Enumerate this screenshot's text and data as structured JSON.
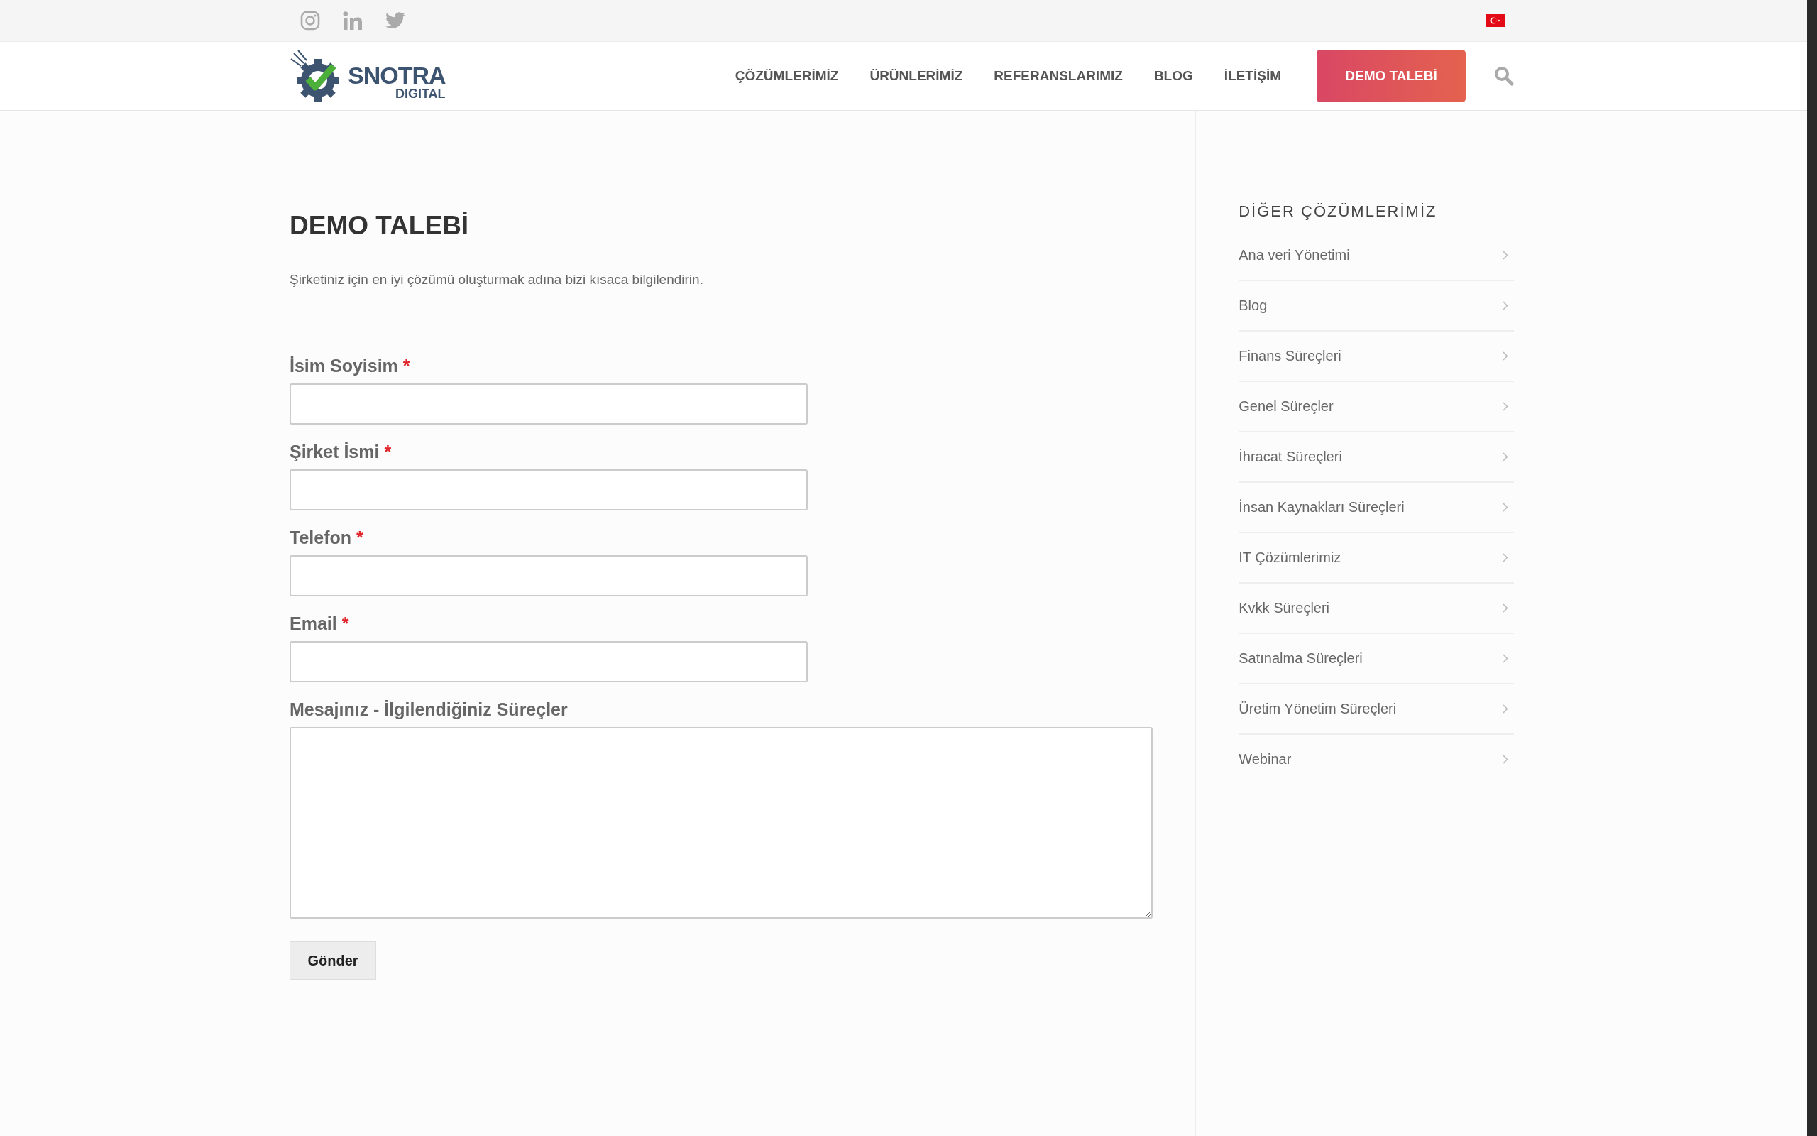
{
  "header": {
    "logo": {
      "name": "SNOTRA",
      "subtitle": "DIGITAL"
    },
    "nav": [
      {
        "label": "ÇÖZÜMLERİMİZ"
      },
      {
        "label": "ÜRÜNLERİMİZ"
      },
      {
        "label": "REFERANSLARIMIZ"
      },
      {
        "label": "BLOG"
      },
      {
        "label": "İLETİŞİM"
      }
    ],
    "cta_button": "DEMO TALEBİ"
  },
  "page": {
    "title": "DEMO TALEBİ",
    "intro": "Şirketiniz için en iyi çözümü oluşturmak adına bizi kısaca bilgilendirin.",
    "fields": [
      {
        "label": "İsim Soyisim",
        "required_mark": "*",
        "kind": "input"
      },
      {
        "label": "Şirket İsmi",
        "required_mark": "*",
        "kind": "input"
      },
      {
        "label": "Telefon",
        "required_mark": "*",
        "kind": "input"
      },
      {
        "label": "Email",
        "required_mark": "*",
        "kind": "input"
      },
      {
        "label": "Mesajınız - İlgilendiğiniz Süreçler",
        "kind": "textarea"
      }
    ],
    "submit_button": "Gönder"
  },
  "sidebar": {
    "title": "DİĞER ÇÖZÜMLERİMİZ",
    "items": [
      "Ana veri Yönetimi",
      "Blog",
      "Finans Süreçleri",
      "Genel Süreçler",
      "İhracat Süreçleri",
      "İnsan Kaynakları Süreçleri",
      "IT Çözümlerimiz",
      "Kvkk Süreçleri",
      "Satınalma Süreçleri",
      "Üretim Yönetim Süreçleri",
      "Webinar"
    ]
  }
}
